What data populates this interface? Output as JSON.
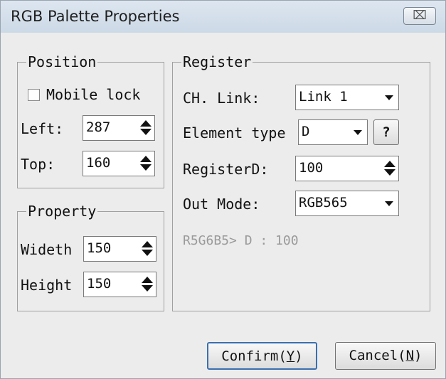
{
  "window": {
    "title": "RGB Palette Properties",
    "close_glyph": "⌧",
    "close_icon": "close-icon"
  },
  "position": {
    "legend": "Position",
    "mobile_lock_label": "Mobile lock",
    "mobile_lock_checked": false,
    "left_label": "Left:",
    "left_value": "287",
    "top_label": "Top:",
    "top_value": "160"
  },
  "property": {
    "legend": "Property",
    "width_label": "Wideth",
    "width_value": "150",
    "height_label": "Height",
    "height_value": "150"
  },
  "register": {
    "legend": "Register",
    "ch_link_label": "CH. Link:",
    "ch_link_value": "Link 1",
    "element_type_label": "Element type",
    "element_type_value": "D",
    "help_label": "?",
    "register_label": "RegisterD:",
    "register_value": "100",
    "out_mode_label": "Out Mode:",
    "out_mode_value": "RGB565",
    "info_text": "R5G6B5> D : 100"
  },
  "buttons": {
    "confirm_text": "Confirm(",
    "confirm_key": "Y",
    "confirm_end": ")",
    "cancel_text": "Cancel(",
    "cancel_key": "N",
    "cancel_end": ")"
  }
}
